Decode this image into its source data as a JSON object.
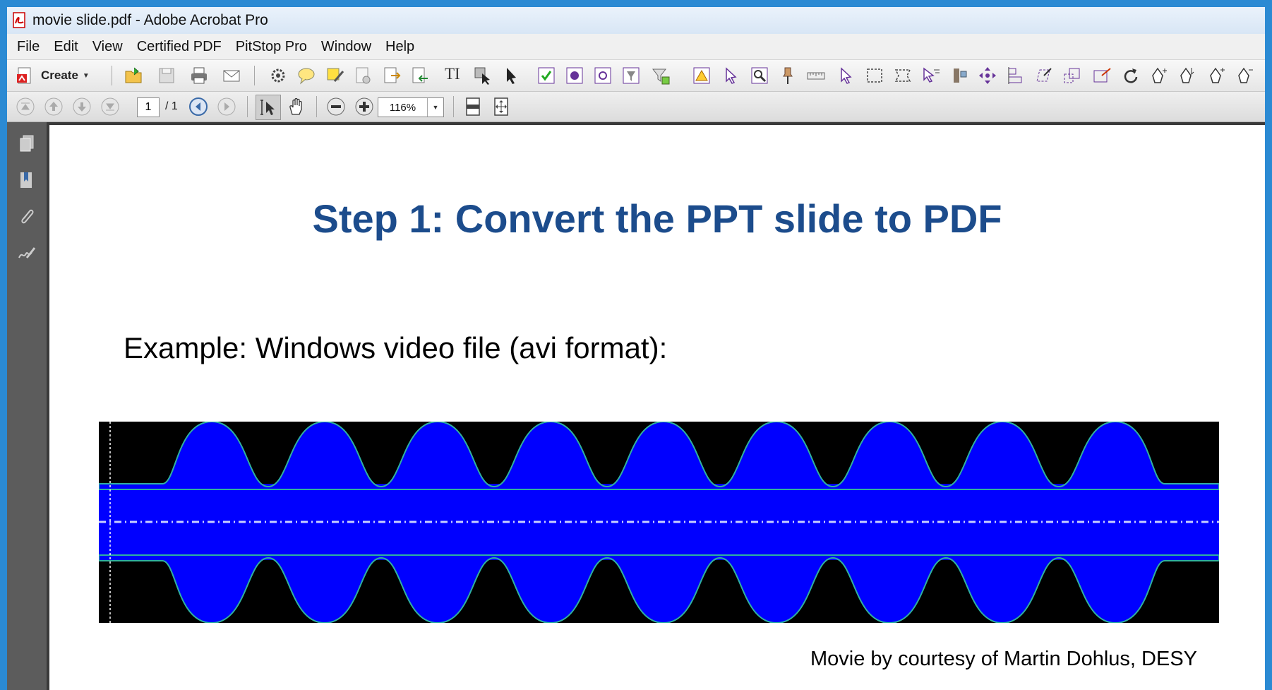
{
  "window": {
    "title": "movie slide.pdf - Adobe Acrobat Pro"
  },
  "menu": [
    "File",
    "Edit",
    "View",
    "Certified PDF",
    "PitStop Pro",
    "Window",
    "Help"
  ],
  "toolbar": {
    "create_label": "Create"
  },
  "navigation": {
    "current_page": "1",
    "page_total": "/ 1",
    "zoom": "116%"
  },
  "document": {
    "title": "Step 1: Convert the PPT slide to PDF",
    "text": "Example: Windows video file (avi format):",
    "caption": "Movie by courtesy of Martin Dohlus, DESY"
  },
  "colors": {
    "title_blue": "#1c4c8c",
    "movie_blue": "#0000ff",
    "window_frame": "#2b8ad3"
  }
}
